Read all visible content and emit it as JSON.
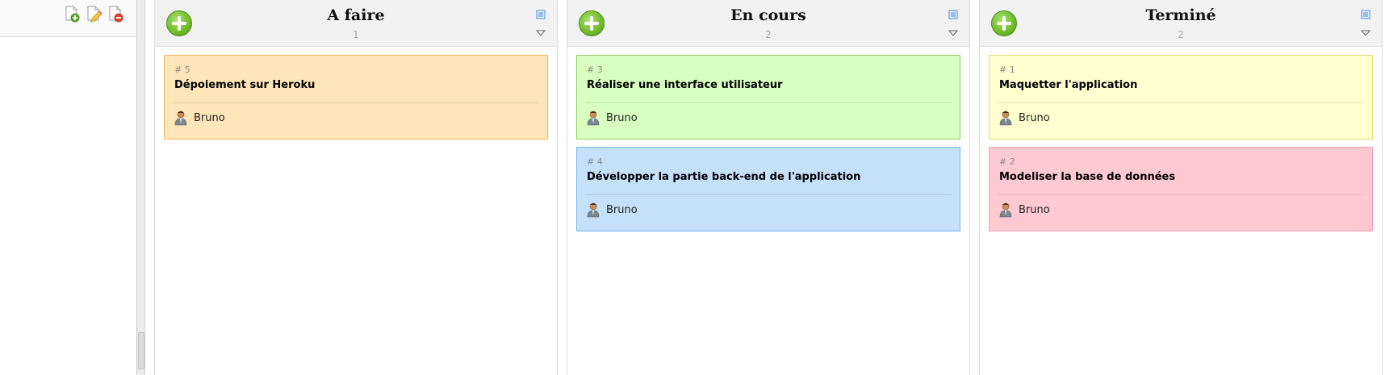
{
  "toolbar": {
    "icons": [
      "add-document-icon",
      "edit-document-icon",
      "delete-document-icon"
    ]
  },
  "columns": [
    {
      "title": "A faire",
      "count": "1",
      "cards": [
        {
          "number": "# 5",
          "title": "Dépoiement sur Heroku",
          "user": "Bruno",
          "color": "#ffe6b8"
        }
      ]
    },
    {
      "title": "En cours",
      "count": "2",
      "cards": [
        {
          "number": "# 3",
          "title": "Réaliser une interface utilisateur",
          "user": "Bruno",
          "color": "#d8ffc0"
        },
        {
          "number": "# 4",
          "title": "Développer la partie back-end de l'application",
          "user": "Bruno",
          "color": "#c5e0fb"
        }
      ]
    },
    {
      "title": "Terminé",
      "count": "2",
      "cards": [
        {
          "number": "# 1",
          "title": "Maquetter l'application",
          "user": "Bruno",
          "color": "#ffffd0"
        },
        {
          "number": "# 2",
          "title": "Modeliser la base de données",
          "user": "Bruno",
          "color": "#ffc9d2"
        }
      ]
    }
  ]
}
